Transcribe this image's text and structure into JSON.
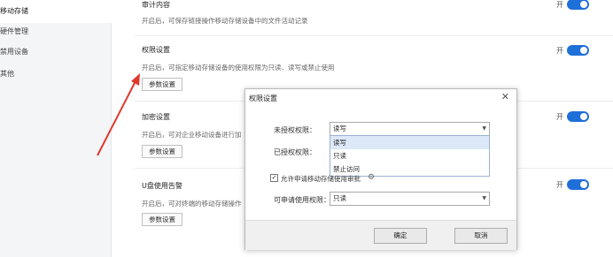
{
  "sidebar": {
    "items": [
      {
        "label": "移动存储"
      },
      {
        "label": "硬件管理"
      },
      {
        "label": "禁用设备"
      },
      {
        "label": "其他"
      }
    ]
  },
  "sections": [
    {
      "title": "审计内容",
      "desc": "开启后，可保存链接操作移动存储设备中的文件活动记录",
      "toggle": "开"
    },
    {
      "title": "权限设置",
      "desc": "开启后，可指定移动存储设备的使用权限为只读、读写或禁止使用",
      "button": "参数设置",
      "toggle": "开"
    },
    {
      "title": "加密设置",
      "desc": "开启后，可对企业移动设备进行加",
      "button": "参数设置",
      "toggle": "开"
    },
    {
      "title": "U盘使用告警",
      "desc": "开启后，可对终端的移动存储操作",
      "button": "参数设置",
      "toggle": "开"
    }
  ],
  "dialog": {
    "title": "权限设置",
    "close": "✕",
    "unauth_label": "未授权权限：",
    "unauth_value": "读写",
    "auth_label": "已授权权限：",
    "dropdown_options": [
      "读写",
      "只读",
      "禁止访问"
    ],
    "checkbox_label": "允许申请移动存储使用审批",
    "checkbox_mark": "✓",
    "gear": "⚙",
    "apply_label": "可申请使用权限：",
    "apply_value": "只读",
    "ok_label": "确定",
    "cancel_label": "取消"
  },
  "colors": {
    "toggle_on": "#1f6fd8",
    "arrow": "#e0392b"
  }
}
